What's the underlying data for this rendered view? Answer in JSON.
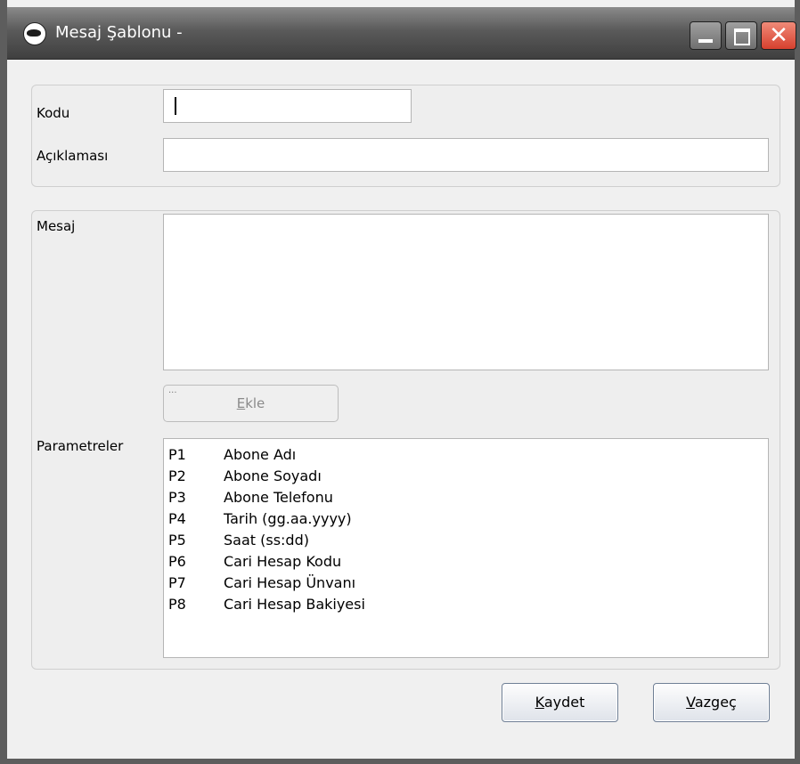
{
  "window": {
    "title": "Mesaj Şablonu -"
  },
  "form": {
    "code_label": "Kodu",
    "code_value": "",
    "description_label": "Açıklaması",
    "description_value": "",
    "message_label": "Mesaj",
    "message_value": "",
    "add_button": {
      "dots": "...",
      "hotkey": "E",
      "rest": "kle"
    },
    "parameters_label": "Parametreler",
    "parameters": [
      {
        "code": "P1",
        "desc": "Abone Adı"
      },
      {
        "code": "P2",
        "desc": "Abone Soyadı"
      },
      {
        "code": "P3",
        "desc": "Abone Telefonu"
      },
      {
        "code": "P4",
        "desc": "Tarih (gg.aa.yyyy)"
      },
      {
        "code": "P5",
        "desc": "Saat (ss:dd)"
      },
      {
        "code": "P6",
        "desc": "Cari Hesap Kodu"
      },
      {
        "code": "P7",
        "desc": "Cari Hesap Ünvanı"
      },
      {
        "code": "P8",
        "desc": "Cari Hesap Bakiyesi"
      }
    ]
  },
  "buttons": {
    "save": {
      "hotkey": "K",
      "rest": "aydet"
    },
    "cancel": {
      "hotkey": "V",
      "rest": "azgeç"
    }
  },
  "colors": {
    "titlebar": "#5a5a5a",
    "close_button": "#d6402e",
    "window_bg": "#f0f0f0"
  }
}
